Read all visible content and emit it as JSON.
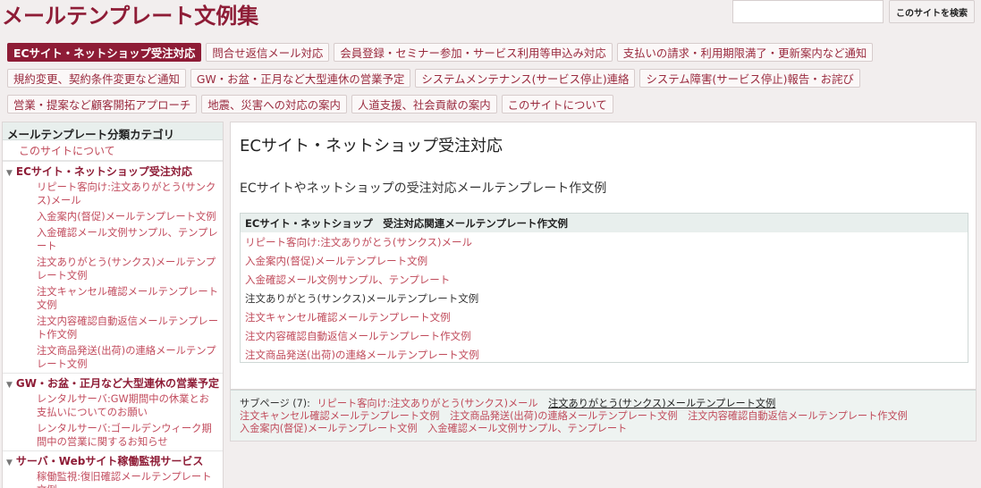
{
  "header": {
    "site_title": "メールテンプレート文例集",
    "search_placeholder": "",
    "search_button": "このサイトを検索"
  },
  "nav": {
    "rows": [
      [
        "ECサイト・ネットショップ受注対応",
        "問合せ返信メール対応",
        "会員登録・セミナー参加・サービス利用等申込み対応",
        "支払いの請求・利用期限満了・更新案内など通知"
      ],
      [
        "規約変更、契約条件変更など通知",
        "GW・お盆・正月など大型連休の営業予定",
        "システムメンテナンス(サービス停止)連絡",
        "システム障害(サービス停止)報告・お詫び"
      ],
      [
        "営業・提案など顧客開拓アプローチ",
        "地震、災害への対応の案内",
        "人道支援、社会貢献の案内",
        "このサイトについて"
      ]
    ],
    "active": "ECサイト・ネットショップ受注対応"
  },
  "sidebar": {
    "heading": "メールテンプレート分類カテゴリ",
    "about": "このサイトについて",
    "categories": [
      {
        "title": "ECサイト・ネットショップ受注対応",
        "items": [
          "リピート客向け:注文ありがとう(サンクス)メール",
          "入金案内(督促)メールテンプレート文例",
          "入金確認メール文例サンプル、テンプレート",
          "注文ありがとう(サンクス)メールテンプレート文例",
          "注文キャンセル確認メールテンプレート文例",
          "注文内容確認自動返信メールテンプレート作文例",
          "注文商品発送(出荷)の連絡メールテンプレート文例"
        ]
      },
      {
        "title": "GW・お盆・正月など大型連休の営業予定",
        "items": [
          "レンタルサーバ:GW期間中の休業とお支払いについてのお願い",
          "レンタルサーバ:ゴールデンウィーク期間中の営業に関するお知らせ"
        ]
      },
      {
        "title": "サーバ・Webサイト稼働監視サービス",
        "items": [
          "稼働監視:復旧確認メールテンプレート文例"
        ]
      }
    ]
  },
  "main": {
    "title": "ECサイト・ネットショップ受注対応",
    "subtitle": "ECサイトやネットショップの受注対応メールテンプレート作文例",
    "box_header": "ECサイト・ネットショップ　受注対応関連メールテンプレート作文例",
    "items": [
      "リピート客向け:注文ありがとう(サンクス)メール",
      "入金案内(督促)メールテンプレート文例",
      "入金確認メール文例サンプル、テンプレート",
      "注文ありがとう(サンクス)メールテンプレート文例",
      "注文キャンセル確認メールテンプレート文例",
      "注文内容確認自動返信メールテンプレート作文例",
      "注文商品発送(出荷)の連絡メールテンプレート文例"
    ],
    "current_item": "注文ありがとう(サンクス)メールテンプレート文例"
  },
  "subpages": {
    "label": "サブページ (7):",
    "links": [
      "リピート客向け:注文ありがとう(サンクス)メール",
      "注文ありがとう(サンクス)メールテンプレート文例",
      "注文キャンセル確認メールテンプレート文例",
      "注文商品発送(出荷)の連絡メールテンプレート文例",
      "注文内容確認自動返信メールテンプレート作文例",
      "入金案内(督促)メールテンプレート文例",
      "入金確認メール文例サンプル、テンプレート"
    ],
    "current": "注文ありがとう(サンクス)メールテンプレート文例"
  },
  "colors": {
    "brand": "#8e1c36",
    "link": "#c04a5a",
    "panel_header": "#e8efed",
    "background": "#f2eeee"
  }
}
